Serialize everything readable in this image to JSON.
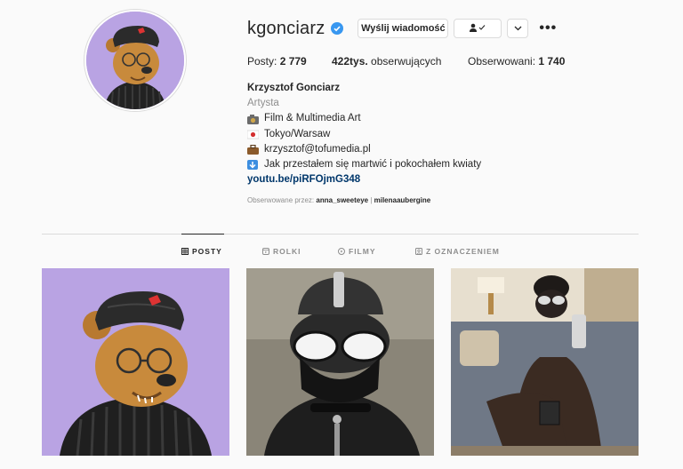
{
  "profile": {
    "username": "kgonciarz",
    "verified": true,
    "message_button": "Wyślij wiadomość",
    "more": "•••"
  },
  "stats": {
    "posts_label": "Posty:",
    "posts_value": "2 779",
    "followers_value": "422tys.",
    "followers_label": "obserwujących",
    "following_label": "Obserwowani:",
    "following_value": "1 740"
  },
  "bio": {
    "name": "Krzysztof Gonciarz",
    "category": "Artysta",
    "lines": [
      {
        "icon": "camera-emoji-icon",
        "text": "Film & Multimedia Art"
      },
      {
        "icon": "japan-flag-icon",
        "text": "Tokyo/Warsaw"
      },
      {
        "icon": "briefcase-emoji-icon",
        "text": "krzysztof@tofumedia.pl"
      },
      {
        "icon": "down-arrow-emoji-icon",
        "text": "Jak przestałem się martwić i pokochałem kwiaty"
      }
    ],
    "link": "youtu.be/piRFOjmG348"
  },
  "followed_by": {
    "label": "Obserwowane przez:",
    "user1": "anna_sweeteye",
    "separator": " | ",
    "user2": "milenaaubergine"
  },
  "tabs": [
    {
      "label": "POSTY",
      "icon": "grid-icon",
      "active": true
    },
    {
      "label": "ROLKI",
      "icon": "reels-icon",
      "active": false
    },
    {
      "label": "FILMY",
      "icon": "play-icon",
      "active": false
    },
    {
      "label": "Z OZNACZENIEM",
      "icon": "tag-icon",
      "active": false
    }
  ],
  "colors": {
    "verified": "#3897f0",
    "link": "#00376b",
    "avatar_bg": "#b9a3e3"
  }
}
